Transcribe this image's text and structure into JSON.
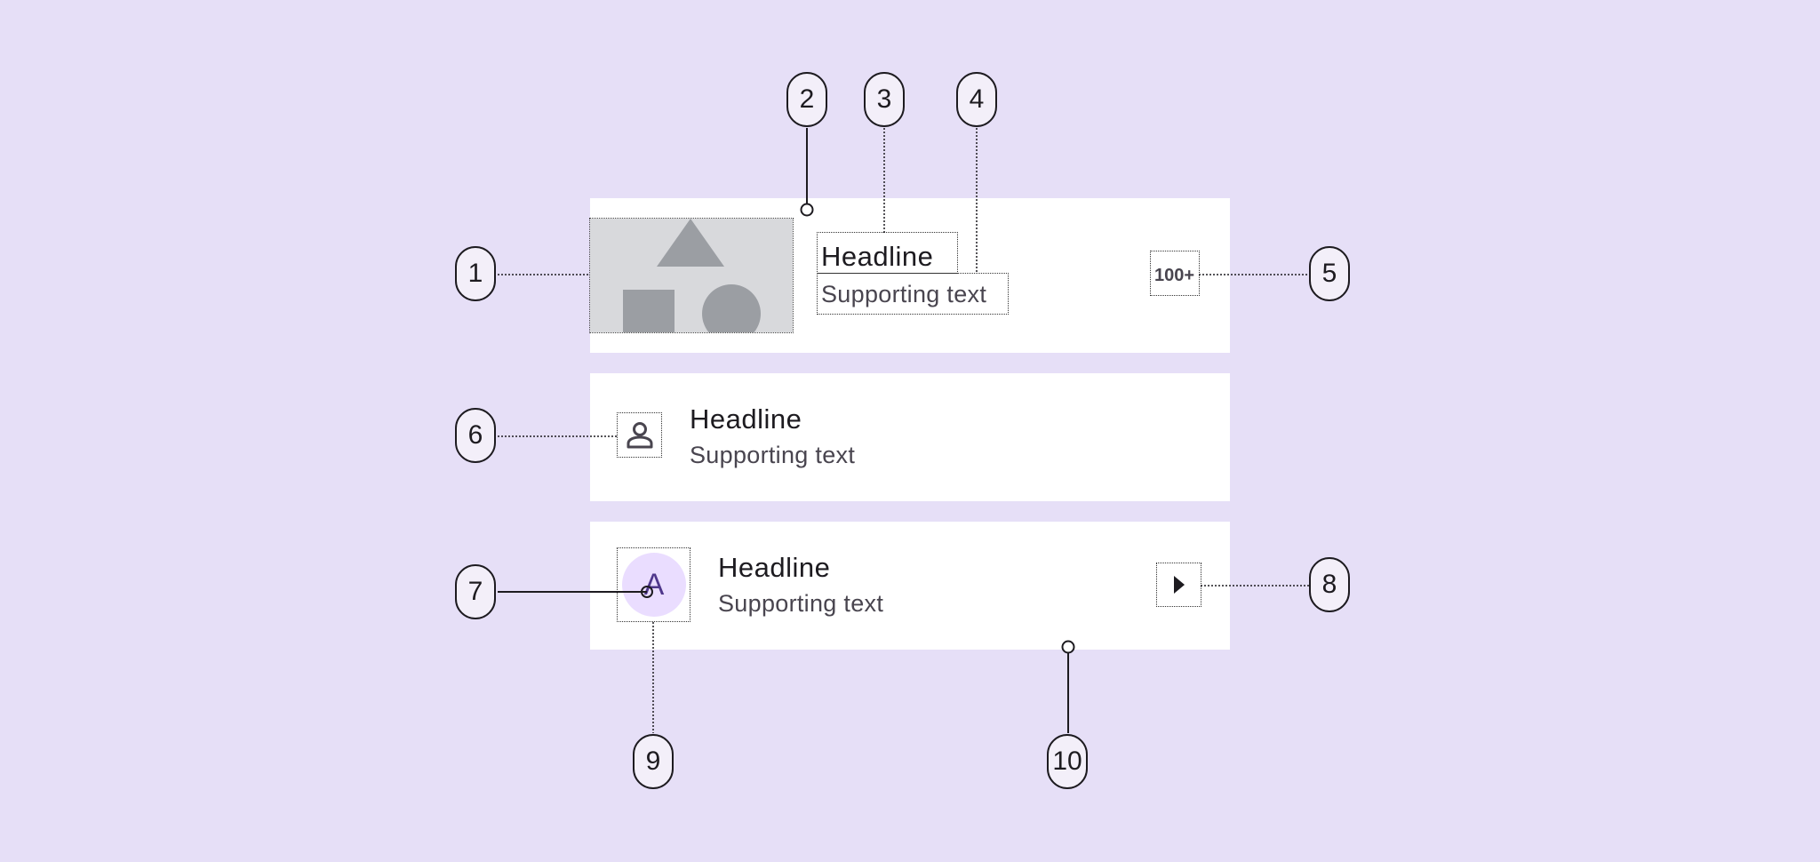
{
  "rows": [
    {
      "headline": "Headline",
      "supporting_text": "Supporting text",
      "trailing_text": "100+"
    },
    {
      "headline": "Headline",
      "supporting_text": "Supporting text"
    },
    {
      "headline": "Headline",
      "supporting_text": "Supporting text",
      "avatar_letter": "A"
    }
  ],
  "callouts": [
    "1",
    "2",
    "3",
    "4",
    "5",
    "6",
    "7",
    "8",
    "9",
    "10"
  ],
  "colors": {
    "background": "#e6dff7",
    "surface": "#ffffff",
    "avatar_container": "#eaddff",
    "avatar_letter": "#4f378b",
    "thumbnail_bg": "#d8d9dc",
    "thumbnail_shapes": "#9b9ea3"
  },
  "icons": [
    "person-icon",
    "play-arrow-icon"
  ]
}
